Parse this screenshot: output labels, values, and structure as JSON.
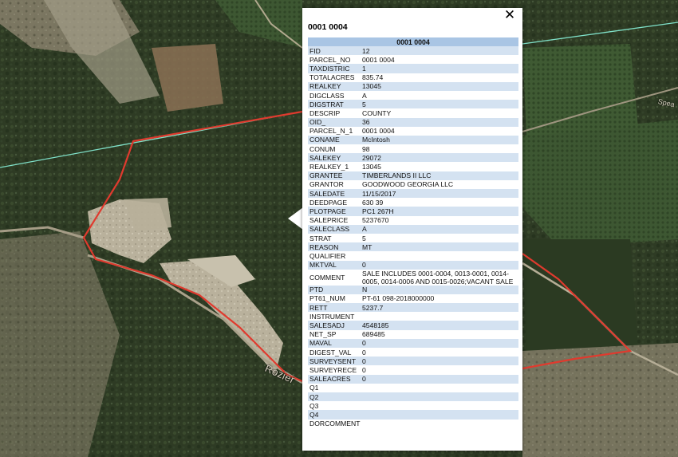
{
  "popup": {
    "title": "0001 0004",
    "header": "0001 0004",
    "close_symbol": "✕",
    "rows": [
      {
        "field": "FID",
        "value": "12"
      },
      {
        "field": "PARCEL_NO",
        "value": "0001 0004"
      },
      {
        "field": "TAXDISTRIC",
        "value": "1"
      },
      {
        "field": "TOTALACRES",
        "value": "835.74"
      },
      {
        "field": "REALKEY",
        "value": "13045"
      },
      {
        "field": "DIGCLASS",
        "value": "A"
      },
      {
        "field": "DIGSTRAT",
        "value": "5"
      },
      {
        "field": "DESCRIP",
        "value": "COUNTY"
      },
      {
        "field": "OID_",
        "value": "36"
      },
      {
        "field": "PARCEL_N_1",
        "value": "0001 0004"
      },
      {
        "field": "CONAME",
        "value": "McIntosh"
      },
      {
        "field": "CONUM",
        "value": "98"
      },
      {
        "field": "SALEKEY",
        "value": "29072"
      },
      {
        "field": "REALKEY_1",
        "value": "13045"
      },
      {
        "field": "GRANTEE",
        "value": "TIMBERLANDS II LLC"
      },
      {
        "field": "GRANTOR",
        "value": "GOODWOOD GEORGIA LLC"
      },
      {
        "field": "SALEDATE",
        "value": "11/15/2017"
      },
      {
        "field": "DEEDPAGE",
        "value": "630 39"
      },
      {
        "field": "PLOTPAGE",
        "value": "PC1 267H"
      },
      {
        "field": "SALEPRICE",
        "value": "5237670"
      },
      {
        "field": "SALECLASS",
        "value": "A"
      },
      {
        "field": "STRAT",
        "value": "5"
      },
      {
        "field": "REASON",
        "value": "MT"
      },
      {
        "field": "QUALIFIER",
        "value": ""
      },
      {
        "field": "MKTVAL",
        "value": "0"
      },
      {
        "field": "COMMENT",
        "value": "SALE INCLUDES 0001-0004, 0013-0001, 0014-0005, 0014-0006 AND 0015-0026;VACANT SALE"
      },
      {
        "field": "PTD",
        "value": "N"
      },
      {
        "field": "PT61_NUM",
        "value": "PT-61 098-2018000000"
      },
      {
        "field": "RETT",
        "value": "5237.7"
      },
      {
        "field": "INSTRUMENT",
        "value": ""
      },
      {
        "field": "SALESADJ",
        "value": "4548185"
      },
      {
        "field": "NET_SP",
        "value": "689485"
      },
      {
        "field": "MAVAL",
        "value": "0"
      },
      {
        "field": "DIGEST_VAL",
        "value": "0"
      },
      {
        "field": "SURVEYSENT",
        "value": "0"
      },
      {
        "field": "SURVEYRECE",
        "value": "0"
      },
      {
        "field": "SALEACRES",
        "value": "0"
      },
      {
        "field": "Q1",
        "value": ""
      },
      {
        "field": "Q2",
        "value": ""
      },
      {
        "field": "Q3",
        "value": ""
      },
      {
        "field": "Q4",
        "value": ""
      },
      {
        "field": "DORCOMMENT",
        "value": ""
      }
    ]
  },
  "map": {
    "road_label": "Rozier",
    "road_label_2": "Spea",
    "parcel_boundary_color": "#e03a2e",
    "powerline_color": "#7fe0c8"
  }
}
